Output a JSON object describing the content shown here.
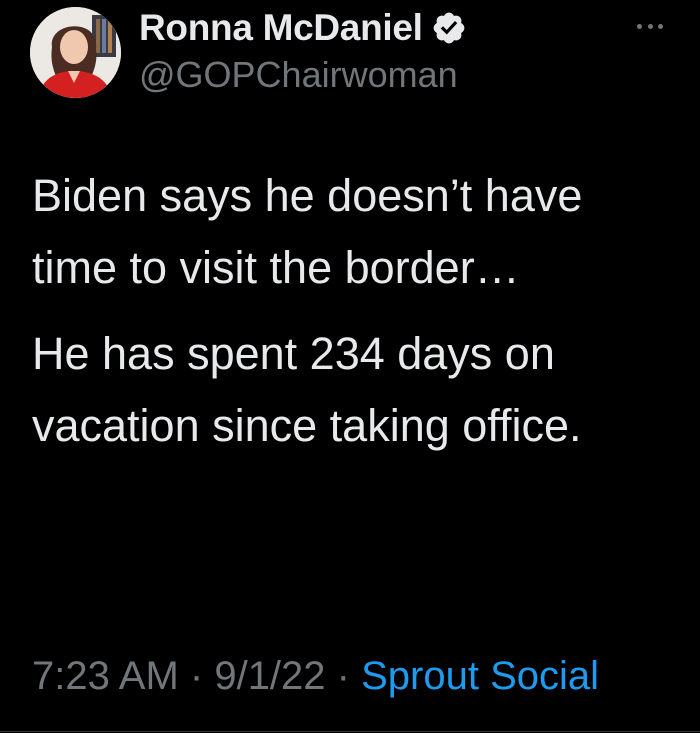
{
  "author": {
    "display_name": "Ronna McDaniel",
    "handle": "@GOPChairwoman",
    "verified_icon": "verified-badge-icon",
    "avatar_icon": "profile-photo"
  },
  "more_icon": "more-options-icon",
  "tweet": {
    "paragraphs": [
      "Biden says he doesn’t have time to visit the border…",
      "He has spent 234 days on vacation since taking office."
    ]
  },
  "meta": {
    "time": "7:23 AM",
    "separator": "·",
    "date": "9/1/22",
    "source": "Sprout Social"
  },
  "colors": {
    "background": "#000000",
    "text_primary": "#e7e9ea",
    "text_secondary": "#71767b",
    "link": "#1d9bf0"
  }
}
